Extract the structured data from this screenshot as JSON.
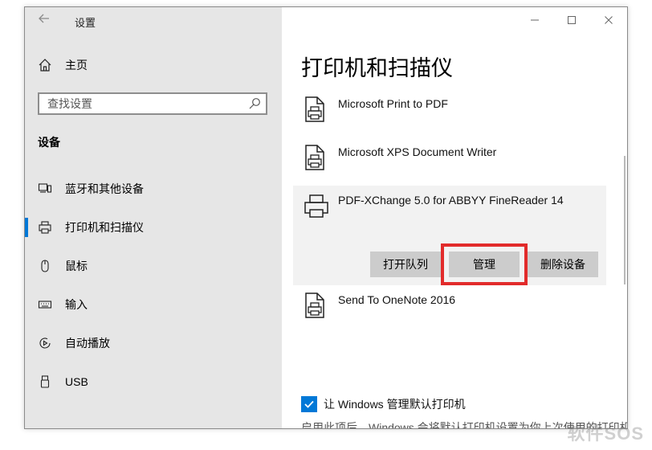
{
  "window": {
    "title": "设置",
    "controls": {
      "minimize": "—",
      "maximize": "□",
      "close": "✕"
    }
  },
  "sidebar": {
    "home_label": "主页",
    "search_placeholder": "查找设置",
    "section_title": "设备",
    "items": [
      {
        "label": "蓝牙和其他设备",
        "icon": "bluetooth-devices-icon",
        "selected": false
      },
      {
        "label": "打印机和扫描仪",
        "icon": "printer-icon",
        "selected": true
      },
      {
        "label": "鼠标",
        "icon": "mouse-icon",
        "selected": false
      },
      {
        "label": "输入",
        "icon": "keyboard-icon",
        "selected": false
      },
      {
        "label": "自动播放",
        "icon": "autoplay-icon",
        "selected": false
      },
      {
        "label": "USB",
        "icon": "usb-icon",
        "selected": false
      }
    ]
  },
  "main": {
    "page_title": "打印机和扫描仪",
    "devices": [
      {
        "name": "Microsoft Print to PDF",
        "icon": "document-printer-icon"
      },
      {
        "name": "Microsoft XPS Document Writer",
        "icon": "document-printer-icon"
      },
      {
        "name": "PDF-XChange 5.0 for ABBYY FineReader 14",
        "icon": "printer-icon",
        "selected": true
      },
      {
        "name": "Send To OneNote 2016",
        "icon": "document-printer-icon"
      }
    ],
    "actions": {
      "open_queue": "打开队列",
      "manage": "管理",
      "remove_device": "删除设备"
    },
    "default_printer_checkbox": {
      "label": "让 Windows 管理默认打印机",
      "checked": true
    },
    "partial_text": "启用此项后，Windows 会将默认打印机设置为你上次使用的打印机"
  },
  "watermark": "软件SOS",
  "colors": {
    "accent": "#0078d7",
    "highlight": "#e22b2b",
    "sidebar_bg": "#e6e6e6"
  }
}
